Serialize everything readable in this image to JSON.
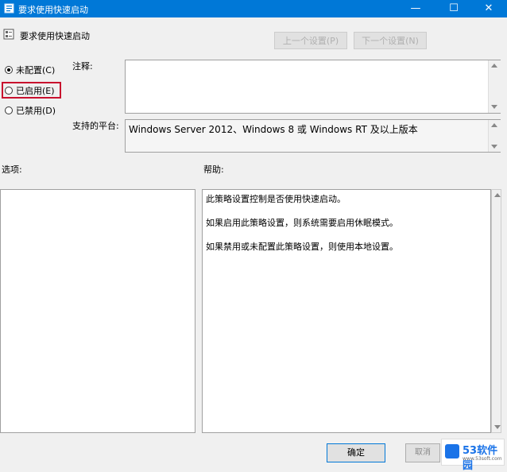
{
  "window": {
    "title": "要求使用快速启动",
    "min": "—",
    "max": "☐",
    "close": "✕"
  },
  "policy": {
    "name": "要求使用快速启动"
  },
  "nav": {
    "prev_label": "上一个设置(P)",
    "next_label": "下一个设置(N)"
  },
  "state": {
    "options": [
      {
        "label": "未配置(C)",
        "checked": true
      },
      {
        "label": "已启用(E)",
        "checked": false
      },
      {
        "label": "已禁用(D)",
        "checked": false
      }
    ]
  },
  "labels": {
    "comment": "注释:",
    "platform": "支持的平台:",
    "options": "选项:",
    "help": "帮助:"
  },
  "platform_text": "Windows Server 2012、Windows 8 或 Windows RT 及以上版本",
  "help_paragraphs": [
    "此策略设置控制是否使用快速启动。",
    "如果启用此策略设置，则系统需要启用休眠模式。",
    "如果禁用或未配置此策略设置，则使用本地设置。"
  ],
  "buttons": {
    "ok": "确定",
    "cancel": "取消"
  },
  "watermark": {
    "brand": "53软件园",
    "url": "www.53soft.com"
  },
  "colors": {
    "titlebar": "#0078d7",
    "highlight": "#c8102e"
  }
}
